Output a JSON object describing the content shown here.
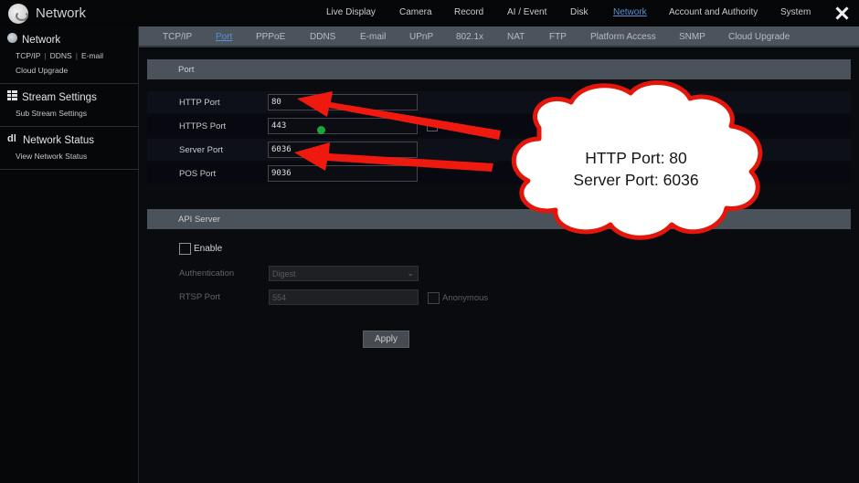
{
  "app": {
    "title": "Network",
    "logo": "logo-icon"
  },
  "topnav": {
    "items": [
      {
        "label": "Live Display",
        "active": false
      },
      {
        "label": "Camera",
        "active": false
      },
      {
        "label": "Record",
        "active": false
      },
      {
        "label": "AI / Event",
        "active": false
      },
      {
        "label": "Disk",
        "active": false
      },
      {
        "label": "Network",
        "active": true
      },
      {
        "label": "Account and Authority",
        "active": false
      },
      {
        "label": "System",
        "active": false
      }
    ],
    "close_icon": "close-icon"
  },
  "sidebar": {
    "groups": [
      {
        "icon": "globe-icon",
        "title": "Network",
        "links": [
          "TCP/IP",
          "DDNS",
          "E-mail",
          "Cloud Upgrade"
        ]
      },
      {
        "icon": "grid-icon",
        "title": "Stream Settings",
        "links": [
          "Sub Stream Settings"
        ]
      },
      {
        "icon": "status-icon",
        "title": "Network Status",
        "links": [
          "View Network Status"
        ]
      }
    ]
  },
  "subtabs": {
    "items": [
      {
        "label": "TCP/IP",
        "active": false
      },
      {
        "label": "Port",
        "active": true
      },
      {
        "label": "PPPoE",
        "active": false
      },
      {
        "label": "DDNS",
        "active": false
      },
      {
        "label": "E-mail",
        "active": false
      },
      {
        "label": "UPnP",
        "active": false
      },
      {
        "label": "802.1x",
        "active": false
      },
      {
        "label": "NAT",
        "active": false
      },
      {
        "label": "FTP",
        "active": false
      },
      {
        "label": "Platform Access",
        "active": false
      },
      {
        "label": "SNMP",
        "active": false
      },
      {
        "label": "Cloud Upgrade",
        "active": false
      }
    ]
  },
  "port_section": {
    "title": "Port",
    "fields": [
      {
        "label": "HTTP Port",
        "value": "80"
      },
      {
        "label": "HTTPS Port",
        "value": "443"
      },
      {
        "label": "Server Port",
        "value": "6036"
      },
      {
        "label": "POS Port",
        "value": "9036"
      }
    ],
    "https_checkbox_checked": false
  },
  "api_section": {
    "title": "API Server",
    "enable_label": "Enable",
    "enable_checked": false,
    "authentication_label": "Authentication",
    "authentication_value": "Digest",
    "rtsp_label": "RTSP Port",
    "rtsp_value": "554",
    "anonymous_label": "Anonymous",
    "anonymous_checked": false,
    "apply_label": "Apply"
  },
  "annotation": {
    "line1": "HTTP Port: 80",
    "line2": "Server Port: 6036",
    "arrow_color": "#f0190f",
    "cloud_border_color": "#e3160c"
  },
  "colors": {
    "accent": "#5b8fd6",
    "section_bar": "#4a535b",
    "background": "#0a0b0e"
  }
}
